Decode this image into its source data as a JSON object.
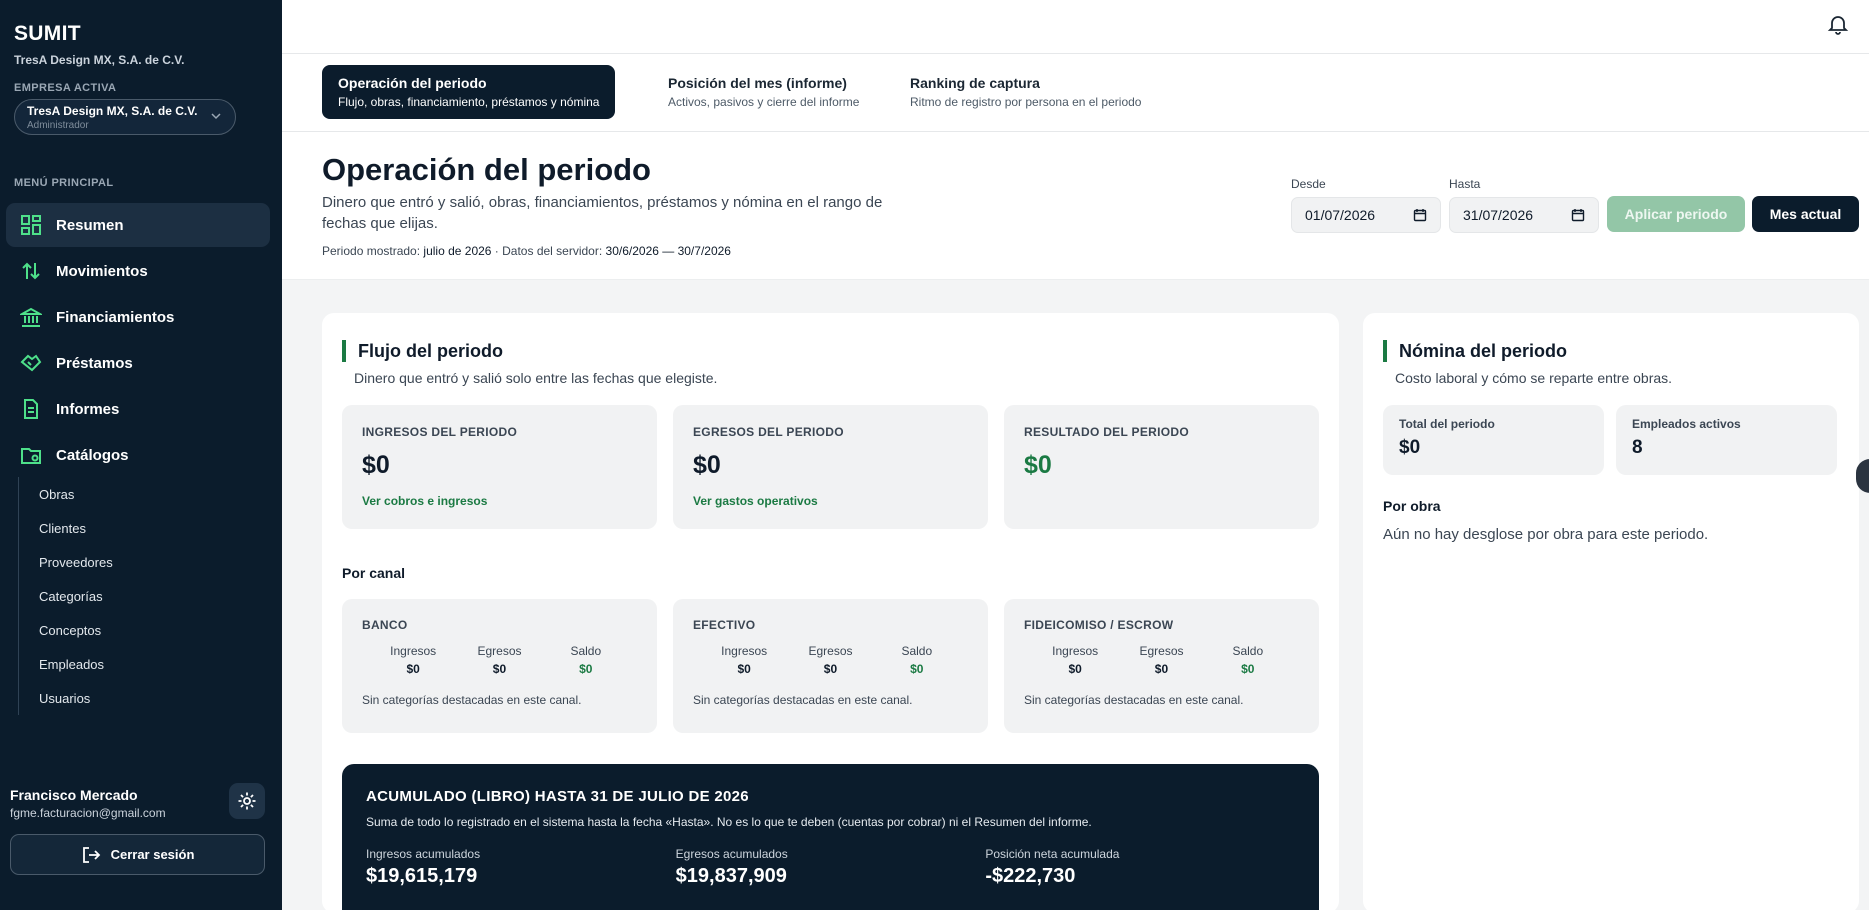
{
  "app": {
    "brand": "SUMIT",
    "company": "TresA Design MX, S.A. de C.V."
  },
  "sidebar": {
    "active_company_label": "EMPRESA ACTIVA",
    "company_select": {
      "name": "TresA Design MX, S.A. de C.V.",
      "role": "Administrador"
    },
    "menu_label": "MENÚ PRINCIPAL",
    "items": [
      {
        "label": "Resumen",
        "icon": "dashboard-icon",
        "active": true
      },
      {
        "label": "Movimientos",
        "icon": "arrows-updown-icon"
      },
      {
        "label": "Financiamientos",
        "icon": "bank-icon"
      },
      {
        "label": "Préstamos",
        "icon": "handshake-icon"
      },
      {
        "label": "Informes",
        "icon": "document-icon"
      },
      {
        "label": "Catálogos",
        "icon": "folder-settings-icon"
      }
    ],
    "sub_items": [
      "Obras",
      "Clientes",
      "Proveedores",
      "Categorías",
      "Conceptos",
      "Empleados",
      "Usuarios"
    ],
    "user": {
      "name": "Francisco Mercado",
      "email": "fgme.facturacion@gmail.com"
    },
    "logout_label": "Cerrar sesión"
  },
  "tabs": [
    {
      "title": "Operación del periodo",
      "subtitle": "Flujo, obras, financiamiento, préstamos y nómina",
      "active": true
    },
    {
      "title": "Posición del mes (informe)",
      "subtitle": "Activos, pasivos y cierre del informe"
    },
    {
      "title": "Ranking de captura",
      "subtitle": "Ritmo de registro por persona en el periodo"
    }
  ],
  "header": {
    "title": "Operación del periodo",
    "description": "Dinero que entró y salió, obras, financiamientos, préstamos y nómina en el rango de fechas que elijas.",
    "period_prefix": "Periodo mostrado:",
    "period_value": "julio de 2026",
    "server_prefix": " · Datos del servidor:",
    "server_value": "30/6/2026 — 30/7/2026",
    "from_label": "Desde",
    "from_value": "01/07/2026",
    "to_label": "Hasta",
    "to_value": "31/07/2026",
    "apply_label": "Aplicar periodo",
    "month_label": "Mes actual"
  },
  "flow": {
    "title": "Flujo del periodo",
    "subtitle": "Dinero que entró y salió solo entre las fechas que elegiste.",
    "cards": [
      {
        "label": "INGRESOS DEL PERIODO",
        "value": "$0",
        "link": "Ver cobros e ingresos"
      },
      {
        "label": "EGRESOS DEL PERIODO",
        "value": "$0",
        "link": "Ver gastos operativos"
      },
      {
        "label": "RESULTADO DEL PERIODO",
        "value": "$0",
        "link": ""
      }
    ],
    "channel_heading": "Por canal",
    "channels": [
      {
        "label": "BANCO",
        "in_h": "Ingresos",
        "in_v": "$0",
        "out_h": "Egresos",
        "out_v": "$0",
        "bal_h": "Saldo",
        "bal_v": "$0",
        "note": "Sin categorías destacadas en este canal."
      },
      {
        "label": "EFECTIVO",
        "in_h": "Ingresos",
        "in_v": "$0",
        "out_h": "Egresos",
        "out_v": "$0",
        "bal_h": "Saldo",
        "bal_v": "$0",
        "note": "Sin categorías destacadas en este canal."
      },
      {
        "label": "FIDEICOMISO / ESCROW",
        "in_h": "Ingresos",
        "in_v": "$0",
        "out_h": "Egresos",
        "out_v": "$0",
        "bal_h": "Saldo",
        "bal_v": "$0",
        "note": "Sin categorías destacadas en este canal."
      }
    ],
    "accumulated": {
      "title": "ACUMULADO (LIBRO) HASTA 31 DE JULIO DE 2026",
      "description": "Suma de todo lo registrado en el sistema hasta la fecha «Hasta». No es lo que te deben (cuentas por cobrar) ni el Resumen del informe.",
      "items": [
        {
          "label": "Ingresos acumulados",
          "value": "$19,615,179"
        },
        {
          "label": "Egresos acumulados",
          "value": "$19,837,909"
        },
        {
          "label": "Posición neta acumulada",
          "value": "-$222,730"
        }
      ]
    }
  },
  "payroll": {
    "title": "Nómina del periodo",
    "subtitle": "Costo laboral y cómo se reparte entre obras.",
    "cards": [
      {
        "label": "Total del periodo",
        "value": "$0"
      },
      {
        "label": "Empleados activos",
        "value": "8"
      }
    ],
    "by_work_heading": "Por obra",
    "by_work_empty": "Aún no hay desglose por obra para este periodo."
  },
  "colors": {
    "sidebar": "#0b1c2c",
    "accent_green": "#1b7a43",
    "apply_button": "#93c6a7"
  }
}
